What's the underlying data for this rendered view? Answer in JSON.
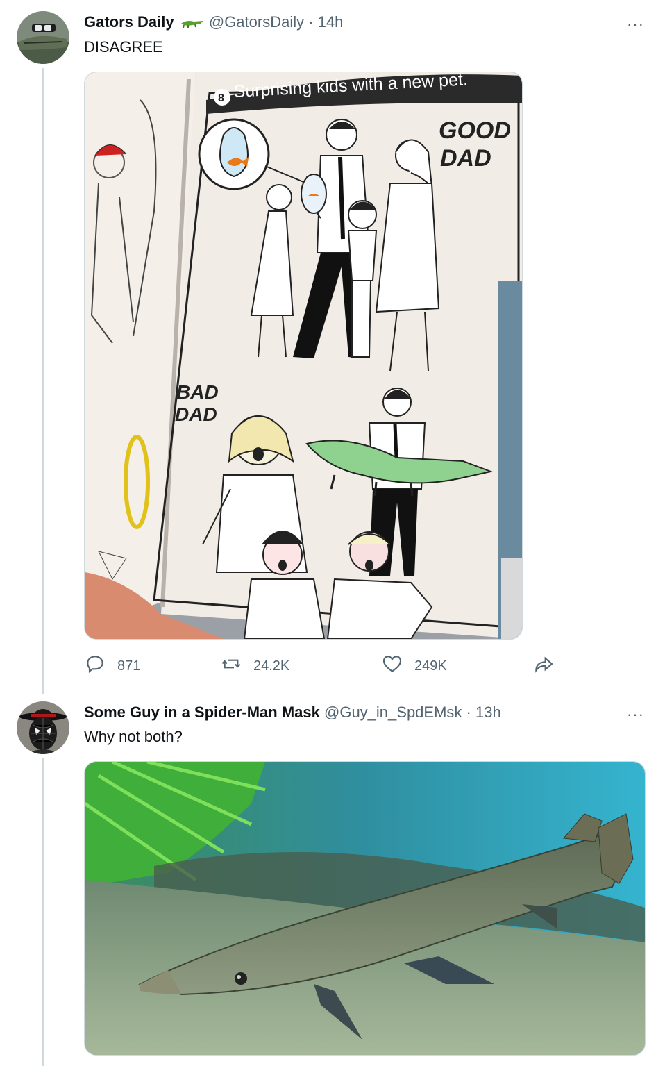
{
  "tweets": [
    {
      "name": "Gators Daily",
      "handle": "@GatorsDaily",
      "separator": "·",
      "time": "14h",
      "more": "···",
      "text": "DISAGREE",
      "image": {
        "banner": "Surprising kids with a new pet.",
        "banner_number": "8",
        "good_label_line1": "GOOD",
        "good_label_line2": "DAD",
        "bad_label_line1": "BAD",
        "bad_label_line2": "DAD"
      },
      "actions": {
        "replies": "871",
        "retweets": "24.2K",
        "likes": "249K"
      }
    },
    {
      "name": "Some Guy in a Spider-Man Mask",
      "handle": "@Guy_in_SpdEMsk",
      "separator": "·",
      "time": "13h",
      "more": "···",
      "text": "Why not both?"
    }
  ],
  "icons": {
    "name_badge": "crocodile-emoji-icon",
    "reply": "reply-icon",
    "retweet": "retweet-icon",
    "like": "heart-icon",
    "share": "share-icon"
  },
  "colors": {
    "text": "#0f1419",
    "secondary": "#536471",
    "border": "#cfd9de",
    "gator_green": "#8fd18f"
  }
}
